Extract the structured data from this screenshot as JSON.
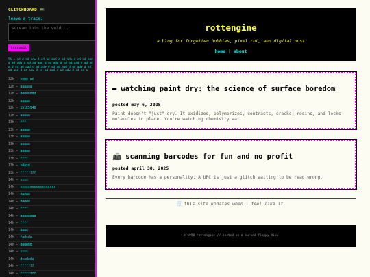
{
  "guestbook": {
    "title": "GLITCHBOARD 📟",
    "prompt": "leave a trace:",
    "placeholder": "scream into the void...",
    "button": "transmit",
    "glitch_text": "5h — ad d ad adw d sd ad aad d ad adw d sd ad aad d ad adw d sd ad aad d ad adw d sd ad aad d ad adw d sd ad aad d ad adw d sd ad aad d ad adw d sd ad aad d ad adw d sd ad aad d ad adw d sd ad a",
    "entries": [
      {
        "time": "12h",
        "msg": "come on"
      },
      {
        "time": "12h",
        "msg": "aaaaaa"
      },
      {
        "time": "12h",
        "msg": "dddddddd"
      },
      {
        "time": "12h",
        "msg": "aaaaa"
      },
      {
        "time": "12h",
        "msg": "151E5940"
      },
      {
        "time": "12h",
        "msg": "aaaaa"
      },
      {
        "time": "13h",
        "msg": "fff"
      },
      {
        "time": "13h",
        "msg": "aaaaa"
      },
      {
        "time": "13h",
        "msg": "aaaaa"
      },
      {
        "time": "13h",
        "msg": "aaaaa"
      },
      {
        "time": "13h",
        "msg": "aaaaa"
      },
      {
        "time": "13h",
        "msg": "ffff"
      },
      {
        "time": "13h",
        "msg": "sdasd"
      },
      {
        "time": "13h",
        "msg": "ffffffff"
      },
      {
        "time": "14h",
        "msg": "ssss"
      },
      {
        "time": "14h",
        "msg": "ssssssssssssssssss"
      },
      {
        "time": "14h",
        "msg": "zazaa"
      },
      {
        "time": "14h",
        "msg": "ddddd"
      },
      {
        "time": "14h",
        "msg": "ffff"
      },
      {
        "time": "14h",
        "msg": "aaaaaaaa"
      },
      {
        "time": "14h",
        "msg": "ffff"
      },
      {
        "time": "14h",
        "msg": "aaaa"
      },
      {
        "time": "14h",
        "msg": "fadsda"
      },
      {
        "time": "14h",
        "msg": "dddddd"
      },
      {
        "time": "14h",
        "msg": "ssss"
      },
      {
        "time": "14h",
        "msg": "dsadada"
      },
      {
        "time": "14h",
        "msg": "fffffff"
      },
      {
        "time": "14h",
        "msg": "ffffffff"
      }
    ]
  },
  "header": {
    "site_title": "rottengine",
    "tagline": "a blog for forgotten hobbies, pixel rot, and digital dust",
    "nav": {
      "home": "home",
      "about": "about",
      "separator": "|"
    }
  },
  "posts": [
    {
      "icon": "▬",
      "title": "watching paint dry: the science of surface boredom",
      "meta": "posted may 6, 2025",
      "body": "Paint doesn't \"just\" dry. It oxidizes, polymerizes, contracts, cracks, resins, and locks molecules in place. You're watching chemistry war."
    },
    {
      "icon": "📠",
      "title": "scanning barcodes for fun and no profit",
      "meta": "posted april 30, 2025",
      "body": "Every barcode has a personality. A UPC is just a glitch waiting to be read wrong."
    }
  ],
  "update_note": "🗒️ this site updates when i feel like it.",
  "footer": "© 1998 rottengine // hosted on a cursed floppy disk",
  "colors": {
    "accent_magenta": "#ff00ff",
    "accent_yellow": "#ffff33",
    "accent_cyan": "#00e5e5",
    "page_bg": "#fdfcf3"
  }
}
